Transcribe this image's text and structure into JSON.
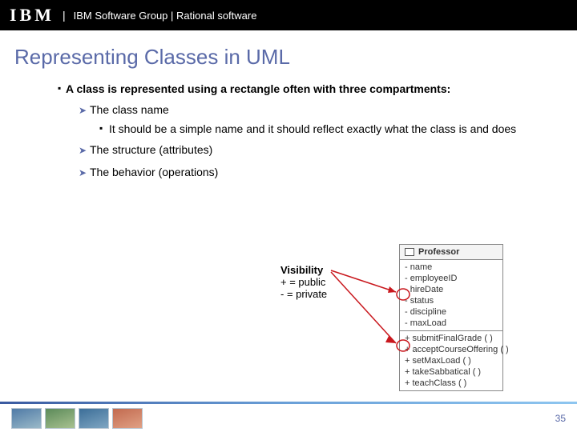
{
  "topbar": {
    "logo": "IBM",
    "text": "IBM Software Group | Rational software"
  },
  "title": "Representing Classes in UML",
  "b1": "A class is represented using a rectangle often with three compartments:",
  "l2a": "The class name",
  "l3a": "It should be a simple name and it should reflect exactly what the class is and does",
  "l2b": "The structure (attributes)",
  "l2c": "The behavior (operations)",
  "vis": {
    "title": "Visibility",
    "pub": "+ = public",
    "priv": "- = private"
  },
  "uml": {
    "name": "Professor",
    "attrs": [
      "- name",
      "- employeeID",
      "- hireDate",
      "- status",
      "- discipline",
      "- maxLoad"
    ],
    "ops": [
      "+ submitFinalGrade ( )",
      "+ acceptCourseOffering ( )",
      "+ setMaxLoad ( )",
      "+ takeSabbatical ( )",
      "+ teachClass ( )"
    ]
  },
  "page": "35"
}
